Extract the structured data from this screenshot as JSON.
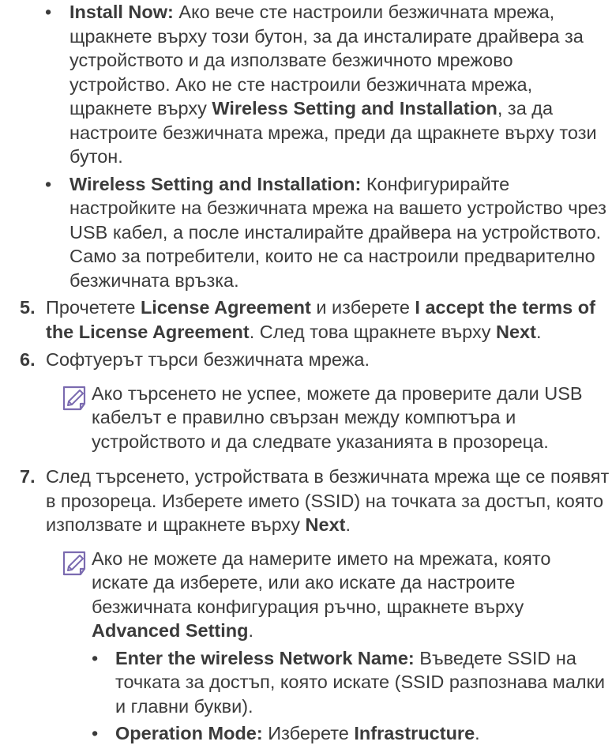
{
  "section_a": {
    "bullets": [
      {
        "marker": "•",
        "runs": [
          {
            "b": true,
            "t": "Install Now:"
          },
          {
            "b": false,
            "t": " Ако вече сте настроили безжичната мрежа, щракнете върху този бутон, за да инсталирате драйвера за устройството и да използвате безжичното мрежово устройство. Ако не сте настроили безжичната мрежа, щракнете върху "
          },
          {
            "b": true,
            "t": "Wireless Setting and Installation"
          },
          {
            "b": false,
            "t": ", за да настроите безжичната мрежа, преди да щракнете върху този бутон."
          }
        ]
      },
      {
        "marker": "•",
        "runs": [
          {
            "b": true,
            "t": "Wireless Setting and Installation:"
          },
          {
            "b": false,
            "t": " Конфигурирайте настройките на безжичната мрежа на вашето устройство чрез USB кабел, а после инсталирайте драйвера на устройството. Само за потребители, които не са настроили предварително безжичната връзка."
          }
        ]
      }
    ]
  },
  "steps": [
    {
      "num": "5.",
      "runs": [
        {
          "b": false,
          "t": "Прочетете "
        },
        {
          "b": true,
          "t": "License Agreement"
        },
        {
          "b": false,
          "t": " и изберете "
        },
        {
          "b": true,
          "t": "I accept the terms of the License Agreement"
        },
        {
          "b": false,
          "t": ". След това щракнете върху "
        },
        {
          "b": true,
          "t": "Next"
        },
        {
          "b": false,
          "t": "."
        }
      ]
    },
    {
      "num": "6.",
      "runs": [
        {
          "b": false,
          "t": "Софтуерът търси безжичната мрежа."
        }
      ],
      "note": {
        "icon": "note-pencil-icon",
        "runs": [
          {
            "b": false,
            "t": "Ако търсенето не успее, можете да проверите дали USB кабелът е правилно свързан между компютъра и устройството и да следвате указанията в прозореца."
          }
        ]
      }
    },
    {
      "num": "7.",
      "runs": [
        {
          "b": false,
          "t": "След търсенето, устройствата в безжичната мрежа ще се появят в прозореца. Изберете името (SSID) на точката за достъп, която използвате и щракнете върху "
        },
        {
          "b": true,
          "t": "Next"
        },
        {
          "b": false,
          "t": "."
        }
      ],
      "note": {
        "icon": "note-pencil-icon",
        "runs": [
          {
            "b": false,
            "t": "Ако не можете да намерите името на мрежата, която искате да изберете, или ако искате да настроите безжичната конфигурация ръчно, щракнете върху "
          },
          {
            "b": true,
            "t": "Advanced Setting"
          },
          {
            "b": false,
            "t": "."
          }
        ],
        "bullets": [
          {
            "marker": "•",
            "runs": [
              {
                "b": true,
                "t": "Enter the wireless Network Name:"
              },
              {
                "b": false,
                "t": " Въведете SSID на точката за достъп, която искате (SSID разпознава малки и главни букви)."
              }
            ]
          },
          {
            "marker": "•",
            "runs": [
              {
                "b": true,
                "t": "Operation Mode:"
              },
              {
                "b": false,
                "t": " Изберете "
              },
              {
                "b": true,
                "t": "Infrastructure"
              },
              {
                "b": false,
                "t": "."
              }
            ]
          }
        ]
      }
    }
  ],
  "colors": {
    "text": "#3b3b3b",
    "icon_stroke": "#7b6bb0"
  }
}
